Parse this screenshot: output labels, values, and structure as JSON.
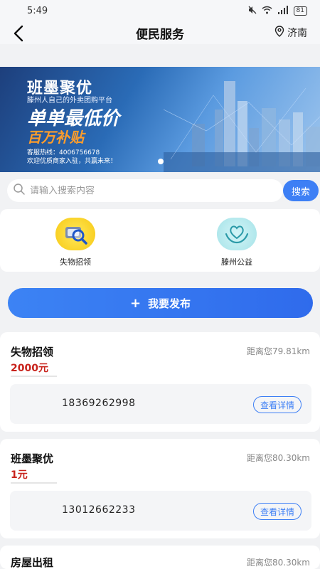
{
  "status": {
    "time": "5:49",
    "battery": "81"
  },
  "nav": {
    "title": "便民服务",
    "location": "济南"
  },
  "banner": {
    "brand": "班墨聚优",
    "tagline": "滕州人自己的外卖团购平台",
    "headline": "单单最低价",
    "subsidy": "百万补贴",
    "hotline": "客服热线：4006756678",
    "welcome": "欢迎优质商家入驻，共赢未来！"
  },
  "search": {
    "placeholder": "请输入搜索内容",
    "button": "搜索"
  },
  "categories": [
    {
      "label": "失物招领",
      "icon": "wallet-magnifier-icon"
    },
    {
      "label": "滕州公益",
      "icon": "heart-hands-icon"
    }
  ],
  "publish": {
    "label": "我要发布"
  },
  "listings": [
    {
      "title": "失物招领",
      "distance": "距离您79.81km",
      "price": "2000元",
      "phone": "18369262998",
      "detail": "查看详情"
    },
    {
      "title": "班墨聚优",
      "distance": "距离您80.30km",
      "price": "1元",
      "phone": "13012662233",
      "detail": "查看详情"
    },
    {
      "title": "房屋出租",
      "distance": "距离您80.30km"
    }
  ],
  "colors": {
    "accent": "#3d7ff5",
    "price": "#c8221b",
    "subsidy": "#ff9d2b"
  }
}
